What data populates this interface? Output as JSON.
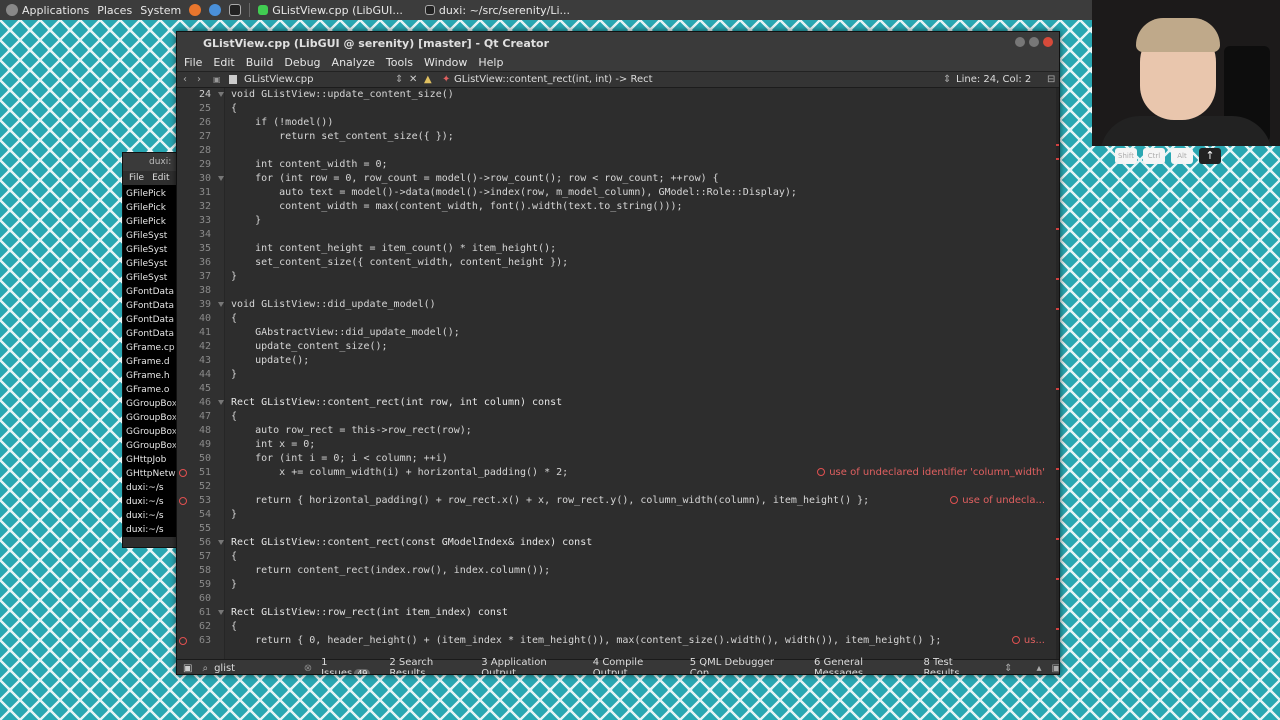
{
  "taskbar": {
    "applications": "Applications",
    "places": "Places",
    "system": "System",
    "task1": "GListView.cpp (LibGUI...",
    "task2": "duxi: ~/src/serenity/Li..."
  },
  "window": {
    "title": "GListView.cpp (LibGUI @ serenity) [master] - Qt Creator"
  },
  "menu": [
    "File",
    "Edit",
    "Build",
    "Debug",
    "Analyze",
    "Tools",
    "Window",
    "Help"
  ],
  "toolbar": {
    "filename": "GListView.cpp",
    "symbol": "GListView::content_rect(int, int) -> Rect",
    "position": "Line: 24, Col: 2"
  },
  "background_window": {
    "title": "duxi:",
    "menu_file": "File",
    "menu_edit": "Edit",
    "items": [
      "GFilePick",
      "GFilePick",
      "GFilePick",
      "GFileSyst",
      "GFileSyst",
      "GFileSyst",
      "GFileSyst",
      "GFontData",
      "GFontData",
      "GFontData",
      "GFontData",
      "GFrame.cp",
      "GFrame.d",
      "GFrame.h",
      "GFrame.o",
      "GGroupBox",
      "GGroupBox",
      "GGroupBox",
      "GGroupBox",
      "GHttpJob",
      "GHttpNetw",
      "duxi:~/s",
      "duxi:~/s",
      "duxi:~/s",
      "duxi:~/s"
    ]
  },
  "code_lines": [
    {
      "n": "24",
      "code": "void GListView::update_content_size()"
    },
    {
      "n": "25",
      "code": "{"
    },
    {
      "n": "26",
      "code": "    if (!model())"
    },
    {
      "n": "27",
      "code": "        return set_content_size({ });"
    },
    {
      "n": "28",
      "code": ""
    },
    {
      "n": "29",
      "code": "    int content_width = 0;"
    },
    {
      "n": "30",
      "code": "    for (int row = 0, row_count = model()->row_count(); row < row_count; ++row) {"
    },
    {
      "n": "31",
      "code": "        auto text = model()->data(model()->index(row, m_model_column), GModel::Role::Display);"
    },
    {
      "n": "32",
      "code": "        content_width = max(content_width, font().width(text.to_string()));"
    },
    {
      "n": "33",
      "code": "    }"
    },
    {
      "n": "34",
      "code": ""
    },
    {
      "n": "35",
      "code": "    int content_height = item_count() * item_height();"
    },
    {
      "n": "36",
      "code": "    set_content_size({ content_width, content_height });"
    },
    {
      "n": "37",
      "code": "}"
    },
    {
      "n": "38",
      "code": ""
    },
    {
      "n": "39",
      "code": "void GListView::did_update_model()"
    },
    {
      "n": "40",
      "code": "{"
    },
    {
      "n": "41",
      "code": "    GAbstractView::did_update_model();"
    },
    {
      "n": "42",
      "code": "    update_content_size();"
    },
    {
      "n": "43",
      "code": "    update();"
    },
    {
      "n": "44",
      "code": "}"
    },
    {
      "n": "45",
      "code": ""
    },
    {
      "n": "46",
      "code": "Rect GListView::content_rect(int row, int column) const"
    },
    {
      "n": "47",
      "code": "{"
    },
    {
      "n": "48",
      "code": "    auto row_rect = this->row_rect(row);"
    },
    {
      "n": "49",
      "code": "    int x = 0;"
    },
    {
      "n": "50",
      "code": "    for (int i = 0; i < column; ++i)"
    },
    {
      "n": "51",
      "code": "        x += column_width(i) + horizontal_padding() * 2;"
    },
    {
      "n": "52",
      "code": ""
    },
    {
      "n": "53",
      "code": "    return { horizontal_padding() + row_rect.x() + x, row_rect.y(), column_width(column), item_height() };"
    },
    {
      "n": "54",
      "code": "}"
    },
    {
      "n": "55",
      "code": ""
    },
    {
      "n": "56",
      "code": "Rect GListView::content_rect(const GModelIndex& index) const"
    },
    {
      "n": "57",
      "code": "{"
    },
    {
      "n": "58",
      "code": "    return content_rect(index.row(), index.column());"
    },
    {
      "n": "59",
      "code": "}"
    },
    {
      "n": "60",
      "code": ""
    },
    {
      "n": "61",
      "code": "Rect GListView::row_rect(int item_index) const"
    },
    {
      "n": "62",
      "code": "{"
    },
    {
      "n": "63",
      "code": "    return { 0, header_height() + (item_index * item_height()), max(content_size().width(), width()), item_height() };"
    }
  ],
  "diagnostics": {
    "l51": "use of undeclared identifier 'column_width'",
    "l53": "use of undecla...",
    "l63": "us..."
  },
  "statusbar": {
    "locator": "glist",
    "issues": "1 Issues",
    "issues_count": "49",
    "search": "2 Search Results",
    "appout": "3 Application Output",
    "compile": "4 Compile Output",
    "qml": "5 QML Debugger Con...",
    "general": "6 General Messages",
    "tests": "8 Test Results"
  },
  "keys": [
    "Shift",
    "Ctrl",
    "Alt",
    "↑"
  ],
  "colors": {
    "keyword": "#e0c060",
    "error": "#e06060",
    "editor_bg": "#2d2d2d"
  }
}
